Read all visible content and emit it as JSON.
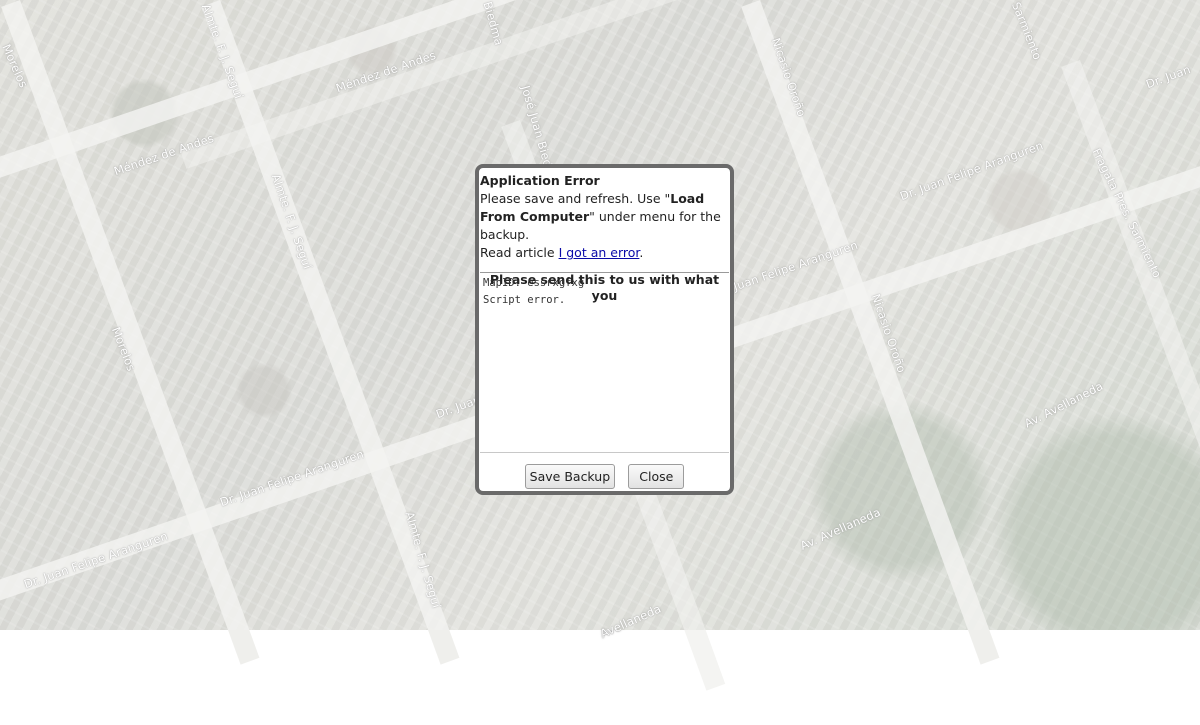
{
  "map": {
    "street_labels": [
      "Morelos",
      "Almte. F. J. Seguí",
      "Méndez de Andes",
      "Méndez de Andes",
      "José Juan Biedma",
      "Nicasio Oroño",
      "Fragata Pres. Sarmiento",
      "Dr. Juan Felipe Aranguren",
      "Dr. Juan Felipe Aranguren",
      "Almte. F. J. Seguí",
      "Morelos",
      "Dr. Juan Felipe Aranguren",
      "Dr. Juan Felipe Aranguren",
      "Nicasio Oroño",
      "Av. Avellaneda",
      "Av. Avellaneda",
      "Almte. F. J. Seguí",
      "Dr. Juan",
      "Fragata Pres. Sarmiento",
      "Sarmiento",
      "Dr. Juan",
      "Biedma",
      "Avellaneda"
    ]
  },
  "dialog": {
    "title": "Application Error",
    "message_part1": "Please save and refresh. Use \"",
    "message_bold": "Load From Computer",
    "message_part2": "\" under menu for the backup.",
    "read_prefix": "Read article ",
    "article_link": "I got an error",
    "read_suffix": ".",
    "send_heading": "Please send this to us with what you",
    "report_text": "MapID: essrxgfxg\nScript error.",
    "save_backup_label": "Save Backup",
    "close_label": "Close"
  }
}
